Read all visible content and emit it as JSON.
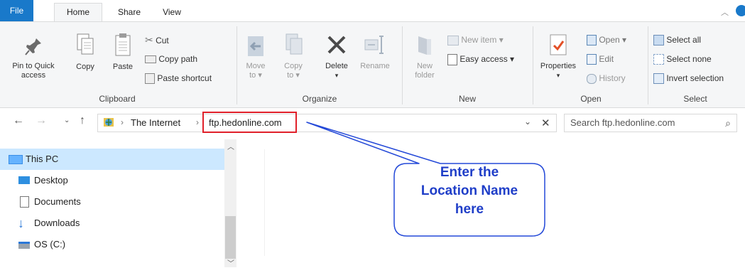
{
  "tabs": {
    "file": "File",
    "home": "Home",
    "share": "Share",
    "view": "View"
  },
  "clipboard": {
    "pin": [
      "Pin to Quick",
      "access"
    ],
    "copy": "Copy",
    "paste": "Paste",
    "cut": "Cut",
    "copy_path": "Copy path",
    "paste_shortcut": "Paste shortcut",
    "label": "Clipboard"
  },
  "organize": {
    "move_to": [
      "Move",
      "to ▾"
    ],
    "copy_to": [
      "Copy",
      "to ▾"
    ],
    "delete": "Delete",
    "delete_arrow": "▾",
    "rename": "Rename",
    "label": "Organize"
  },
  "new": {
    "new_folder": [
      "New",
      "folder"
    ],
    "new_item": "New item ▾",
    "easy_access": "Easy access ▾",
    "label": "New"
  },
  "open": {
    "properties": "Properties",
    "properties_arrow": "▾",
    "open": "Open ▾",
    "edit": "Edit",
    "history": "History",
    "label": "Open"
  },
  "select": {
    "select_all": "Select all",
    "select_none": "Select none",
    "invert": "Invert selection",
    "label": "Select"
  },
  "address": {
    "crumb1": "The Internet",
    "sep": "›",
    "current": "ftp.hedonline.com"
  },
  "search": {
    "placeholder": "Search ftp.hedonline.com"
  },
  "nav": [
    "This PC",
    "Desktop",
    "Documents",
    "Downloads",
    "OS (C:)"
  ],
  "callout": {
    "lines": [
      "Enter the",
      "Location Name",
      "here"
    ]
  },
  "colors": {
    "accent": "#1979ca",
    "highlight_box": "#e0202a",
    "callout_text": "#1f3ec8"
  }
}
